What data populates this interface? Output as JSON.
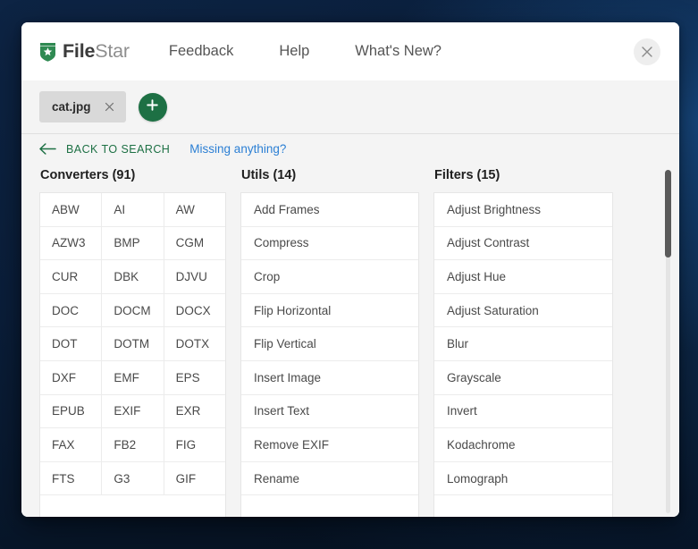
{
  "header": {
    "brand_file": "File",
    "brand_star": "Star",
    "logo_icon": "shield-star-icon",
    "nav": [
      {
        "label": "Feedback"
      },
      {
        "label": "Help"
      },
      {
        "label": "What's New?"
      }
    ],
    "close_icon": "close-icon"
  },
  "filebar": {
    "files": [
      {
        "name": "cat.jpg",
        "close_icon": "close-icon"
      }
    ],
    "add_icon": "plus-icon",
    "add_label": "+"
  },
  "subbar": {
    "back_label": "BACK TO SEARCH",
    "back_icon": "arrow-left-icon",
    "missing_label": "Missing anything?"
  },
  "colors": {
    "brand_green": "#1d7044",
    "link_blue": "#2b7fd4",
    "chip_gray": "#d9d9d9",
    "panel_bg": "#f4f4f4",
    "desktop_bg": "#0c2240"
  },
  "columns": [
    {
      "key": "converters",
      "title": "Converters (91)",
      "layout": "grid3",
      "rows": [
        [
          "ABW",
          "AI",
          "AW"
        ],
        [
          "AZW3",
          "BMP",
          "CGM"
        ],
        [
          "CUR",
          "DBK",
          "DJVU"
        ],
        [
          "DOC",
          "DOCM",
          "DOCX"
        ],
        [
          "DOT",
          "DOTM",
          "DOTX"
        ],
        [
          "DXF",
          "EMF",
          "EPS"
        ],
        [
          "EPUB",
          "EXIF",
          "EXR"
        ],
        [
          "FAX",
          "FB2",
          "FIG"
        ],
        [
          "FTS",
          "G3",
          "GIF"
        ]
      ]
    },
    {
      "key": "utils",
      "title": "Utils (14)",
      "layout": "list",
      "rows": [
        "Add Frames",
        "Compress",
        "Crop",
        "Flip Horizontal",
        "Flip Vertical",
        "Insert Image",
        "Insert Text",
        "Remove EXIF",
        "Rename"
      ]
    },
    {
      "key": "filters",
      "title": "Filters (15)",
      "layout": "list",
      "rows": [
        "Adjust Brightness",
        "Adjust Contrast",
        "Adjust Hue",
        "Adjust Saturation",
        "Blur",
        "Grayscale",
        "Invert",
        "Kodachrome",
        "Lomograph"
      ]
    }
  ]
}
